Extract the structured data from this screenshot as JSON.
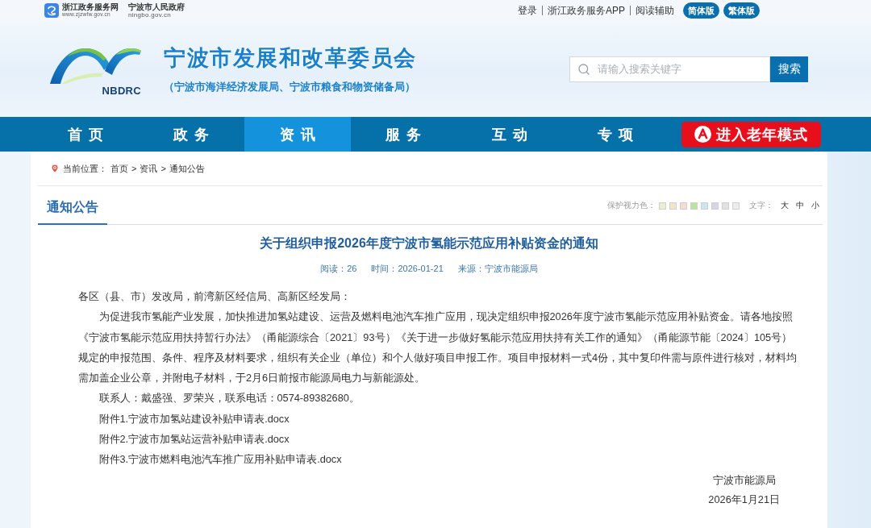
{
  "top_bar": {
    "portal_name": "浙江政务服务网",
    "portal_url": "www.zjzwfw.gov.cn",
    "gov_name": "宁波市人民政府",
    "gov_url": "ningbo.gov.cn",
    "links": [
      "登录",
      "浙江政务服务APP",
      "阅读辅助"
    ],
    "version_buttons": [
      "简体版",
      "繁体版"
    ]
  },
  "header": {
    "logo_text": "NBDRC",
    "title": "宁波市发展和改革委员会",
    "subtitle": "（宁波市海洋经济发展局、宁波市粮食和物资储备局）",
    "search": {
      "placeholder": "请输入搜索关键字",
      "button": "搜索"
    }
  },
  "nav": {
    "items": [
      {
        "label": "首页",
        "selected": false
      },
      {
        "label": "政务",
        "selected": false
      },
      {
        "label": "资讯",
        "selected": true
      },
      {
        "label": "服务",
        "selected": false
      },
      {
        "label": "互动",
        "selected": false
      },
      {
        "label": "专项",
        "selected": false
      }
    ],
    "elder_mode_button": "进入老年模式"
  },
  "breadcrumb": {
    "label": "当前位置：",
    "separator": ">",
    "path": [
      "首页",
      "资讯",
      "通知公告"
    ]
  },
  "section": {
    "tab": "通知公告",
    "display_options": {
      "eye_care_label": "保护视力色：",
      "swatches": [
        {
          "color": "#eaf0cf"
        },
        {
          "color": "#f3e5c8"
        },
        {
          "color": "#f5dcd2"
        },
        {
          "color": "#b6e59e"
        },
        {
          "color": "#c7e8ef"
        },
        {
          "color": "#d9d2ef"
        },
        {
          "color": "#e2e2e2"
        },
        {
          "color": "#ececec"
        }
      ],
      "font_size_label": "文字：",
      "font_sizes": [
        "大",
        "中",
        "小"
      ]
    }
  },
  "article": {
    "title": "关于组织申报2026年度宁波市氢能示范应用补贴资金的通知",
    "meta": [
      "阅读：26",
      "时间：2026-01-21",
      "来源：宁波市能源局"
    ],
    "paragraphs": [
      {
        "indent": false,
        "lines": [
          "各区（县、市）发改局，前湾新区经信局、高新区经发局："
        ]
      },
      {
        "indent": true,
        "lines": [
          "为促进我市氢能产业发展，加快推进加氢站建设、运营及燃料电池汽车推广应用，现决定组织申报2026年度宁波市氢能示范应用补贴资金。请各地按照",
          "《宁波市氢能示范应用扶持暂行办法》（甬能源综合〔2021〕93号）《关于进一步做好氢能示范应用扶持有关工作的通知》（甬能源节能〔2024〕105号）",
          "规定的申报范围、条件、程序及材料要求，组织有关企业（单位）和个人做好项目申报工作。项目申报材料一式4份，其中复印件需与原件进行核对，材料均",
          "需加盖企业公章，并附电子材料，于2月6日前报市能源局电力与新能源处。"
        ]
      },
      {
        "indent": true,
        "lines": [
          "联系人：戴盛强、罗荣兴，联系电话：0574-89382680。"
        ]
      },
      {
        "indent": true,
        "lines": [
          "附件1.宁波市加氢站建设补贴申请表.docx"
        ]
      },
      {
        "indent": true,
        "lines": [
          "附件2.宁波市加氢站运营补贴申请表.docx"
        ]
      },
      {
        "indent": true,
        "lines": [
          "附件3.宁波市燃料电池汽车推广应用补贴申请表.docx"
        ]
      }
    ],
    "signature": {
      "issuer": "宁波市能源局",
      "date": "2026年1月21日"
    }
  }
}
